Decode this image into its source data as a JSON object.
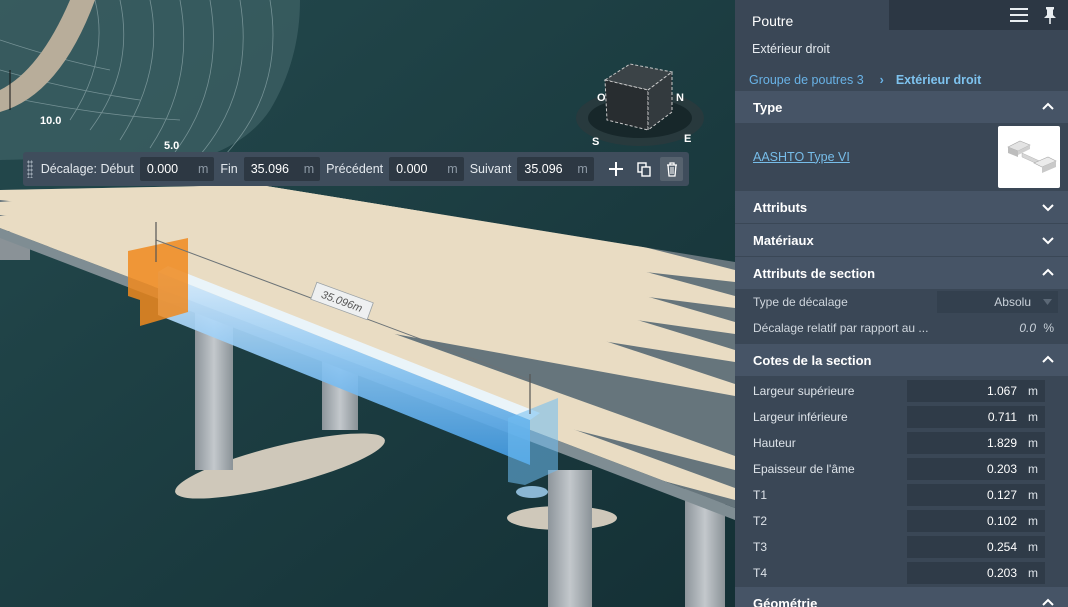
{
  "toolbar": {
    "debut_label": "Décalage: Début",
    "debut_value": "0.000",
    "fin_label": "Fin",
    "fin_value": "35.096",
    "precedent_label": "Précédent",
    "precedent_value": "0.000",
    "suivant_label": "Suivant",
    "suivant_value": "35.096",
    "unit": "m",
    "buttons": [
      "plus-icon",
      "copy-icon",
      "trash-icon"
    ]
  },
  "viewport": {
    "contour_labels": [
      "10.0",
      "5.0"
    ],
    "dimension_label": "35.096m",
    "viewcube_letters": [
      "O",
      "N",
      "S",
      "E"
    ],
    "highlight_color": "#4aa8ee",
    "start_marker_color": "#f08a1f"
  },
  "panel": {
    "title": "Poutre",
    "subtitle": "Extérieur droit",
    "header_icons": [
      "menu-icon",
      "pin-icon"
    ],
    "breadcrumb": {
      "parent": "Groupe de poutres 3",
      "current": "Extérieur droit"
    },
    "sections": {
      "type": "Type",
      "attributs": "Attributs",
      "materiaux": "Matériaux",
      "attributs_section": "Attributs de section",
      "cotes": "Cotes de la section",
      "geometrie": "Géométrie"
    },
    "type_link": "AASHTO Type VI",
    "section_attrs": [
      {
        "label": "Type de décalage",
        "value": "Absolu"
      },
      {
        "label": "Décalage relatif par rapport au ...",
        "value": "0.0",
        "unit": "%"
      }
    ],
    "dimensions": [
      {
        "label": "Largeur supérieure",
        "value": "1.067",
        "unit": "m"
      },
      {
        "label": "Largeur inférieure",
        "value": "0.711",
        "unit": "m"
      },
      {
        "label": "Hauteur",
        "value": "1.829",
        "unit": "m"
      },
      {
        "label": "Epaisseur de l'âme",
        "value": "0.203",
        "unit": "m"
      },
      {
        "label": "T1",
        "value": "0.127",
        "unit": "m"
      },
      {
        "label": "T2",
        "value": "0.102",
        "unit": "m"
      },
      {
        "label": "T3",
        "value": "0.254",
        "unit": "m"
      },
      {
        "label": "T4",
        "value": "0.203",
        "unit": "m"
      }
    ]
  }
}
